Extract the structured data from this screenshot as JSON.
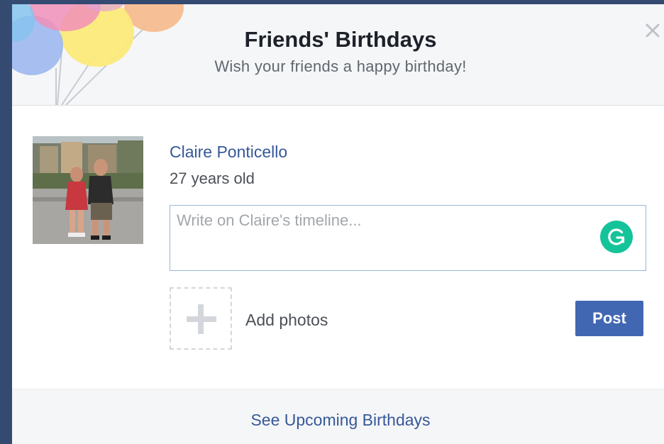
{
  "dialog": {
    "title": "Friends' Birthdays",
    "subtitle": "Wish your friends a happy birthday!",
    "close_icon": "close-x-icon"
  },
  "friend": {
    "name": "Claire Ponticello",
    "age": "27 years old",
    "post_placeholder": "Write on Claire's timeline...",
    "post_value": ""
  },
  "composer": {
    "add_photos_label": "Add photos",
    "add_photos_icon": "plus-icon",
    "grammarly_icon": "grammarly-icon",
    "post_label": "Post"
  },
  "footer": {
    "link_label": "See Upcoming Birthdays"
  },
  "colors": {
    "accent": "#4267b2",
    "link": "#365899",
    "grammarly": "#15c39a",
    "background": "#344a70"
  }
}
